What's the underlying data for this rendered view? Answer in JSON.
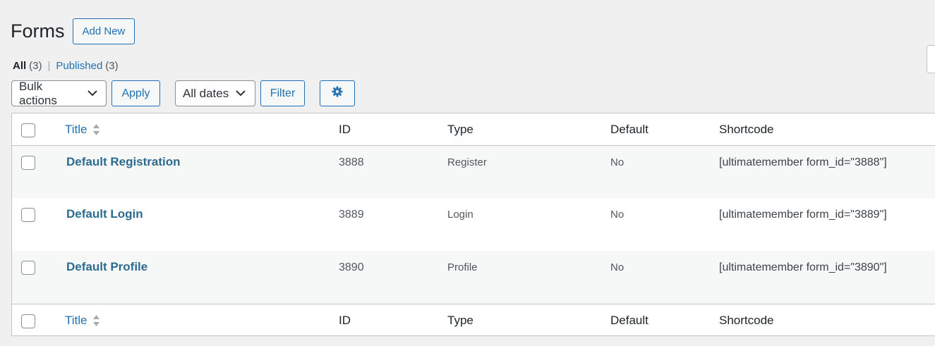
{
  "header": {
    "title": "Forms",
    "add_new_label": "Add New"
  },
  "views": {
    "all_label": "All",
    "all_count": "(3)",
    "separator": "|",
    "published_label": "Published",
    "published_count": "(3)"
  },
  "tablenav": {
    "bulk_actions": "Bulk actions",
    "apply_label": "Apply",
    "dates": "All dates",
    "filter_label": "Filter",
    "settings_icon": "gear-icon"
  },
  "table": {
    "columns": {
      "title": "Title",
      "id": "ID",
      "type": "Type",
      "default": "Default",
      "shortcode": "Shortcode"
    },
    "rows": [
      {
        "title": "Default Registration",
        "id": "3888",
        "type": "Register",
        "default": "No",
        "shortcode": "[ultimatemember form_id=\"3888\"]"
      },
      {
        "title": "Default Login",
        "id": "3889",
        "type": "Login",
        "default": "No",
        "shortcode": "[ultimatemember form_id=\"3889\"]"
      },
      {
        "title": "Default Profile",
        "id": "3890",
        "type": "Profile",
        "default": "No",
        "shortcode": "[ultimatemember form_id=\"3890\"]"
      }
    ]
  },
  "colors": {
    "accent": "#2271b1",
    "background": "#f0f0f1",
    "row_alt": "#f6f7f7"
  }
}
